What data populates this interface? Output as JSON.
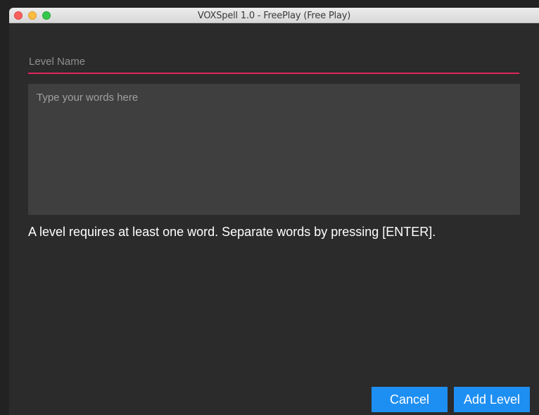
{
  "window": {
    "title": "VOXSpell 1.0 - FreePlay (Free Play)"
  },
  "form": {
    "level_name_placeholder": "Level Name",
    "level_name_value": "",
    "words_placeholder": "Type your words here",
    "words_value": "",
    "hint": "A level requires at least one word. Separate words by pressing [ENTER]."
  },
  "buttons": {
    "cancel_label": "Cancel",
    "add_level_label": "Add Level"
  },
  "colors": {
    "accent_underline": "#e0245e",
    "button_blue": "#1e8ff2",
    "background": "#2b2b2b",
    "textarea_bg": "#3f3f3f"
  }
}
